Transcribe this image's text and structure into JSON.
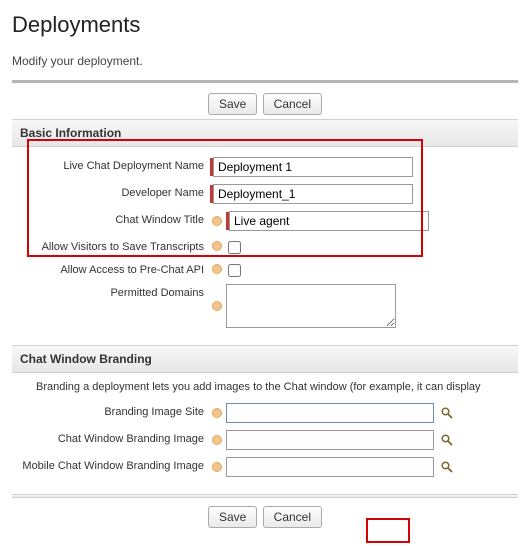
{
  "page": {
    "title": "Deployments",
    "subtitle": "Modify your deployment."
  },
  "buttons": {
    "save": "Save",
    "cancel": "Cancel"
  },
  "sections": {
    "basic": "Basic Information",
    "branding": "Chat Window Branding"
  },
  "branding_desc": "Branding a deployment lets you add images to the Chat window (for example, it can display",
  "fields": {
    "deployment_name": {
      "label": "Live Chat Deployment Name",
      "value": "Deployment 1"
    },
    "developer_name": {
      "label": "Developer Name",
      "value": "Deployment_1"
    },
    "chat_title": {
      "label": "Chat Window Title",
      "value": "Live agent"
    },
    "allow_save": {
      "label": "Allow Visitors to Save Transcripts"
    },
    "allow_prechat": {
      "label": "Allow Access to Pre-Chat API"
    },
    "permitted": {
      "label": "Permitted Domains",
      "value": ""
    },
    "branding_site": {
      "label": "Branding Image Site",
      "value": ""
    },
    "branding_image": {
      "label": "Chat Window Branding Image",
      "value": ""
    },
    "mobile_image": {
      "label": "Mobile Chat Window Branding Image",
      "value": ""
    }
  }
}
